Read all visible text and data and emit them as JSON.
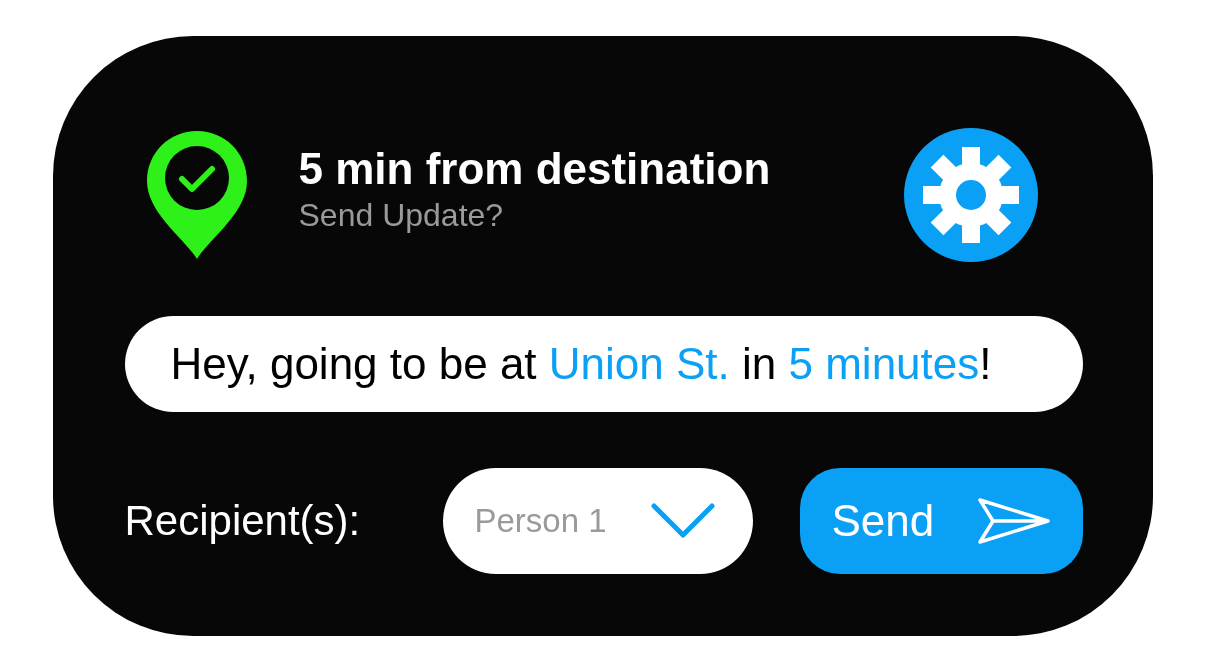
{
  "notification": {
    "title": "5 min from destination",
    "subtitle": "Send Update?"
  },
  "message": {
    "segments": [
      {
        "text": "Hey, going to be at ",
        "highlighted": false
      },
      {
        "text": "Union St.",
        "highlighted": true
      },
      {
        "text": " in ",
        "highlighted": false
      },
      {
        "text": "5 minutes",
        "highlighted": true
      },
      {
        "text": "!",
        "highlighted": false
      }
    ]
  },
  "recipient": {
    "label": "Recipient(s):",
    "placeholder": "Person 1"
  },
  "send_button": {
    "label": "Send"
  }
}
